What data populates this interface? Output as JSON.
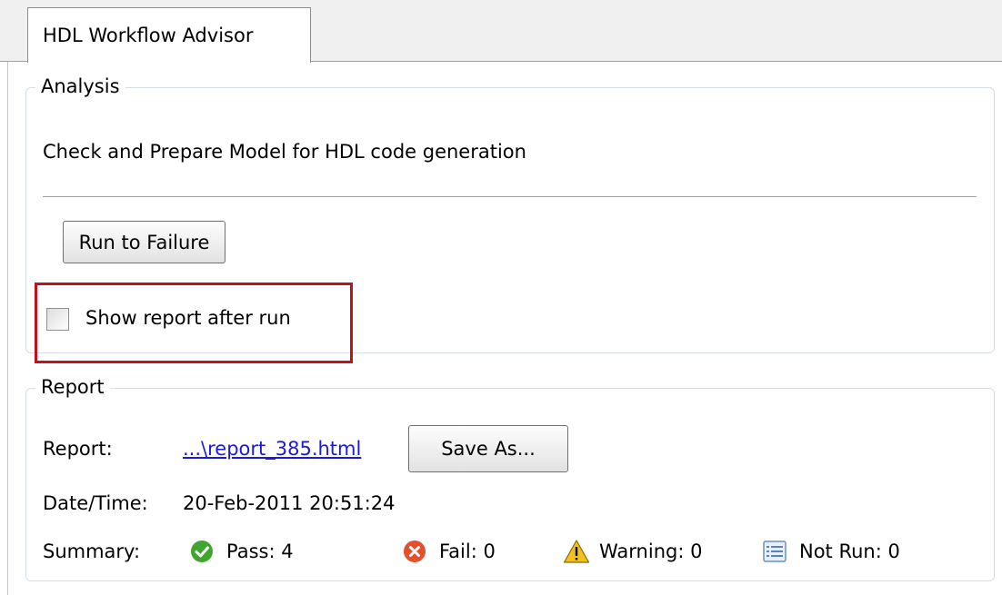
{
  "tab": {
    "label": "HDL Workflow Advisor"
  },
  "analysis": {
    "title": "Analysis",
    "description": "Check and Prepare Model for HDL code generation",
    "run_button": "Run to Failure",
    "show_report_label": "Show report after run",
    "show_report_checked": false
  },
  "report": {
    "title": "Report",
    "report_label": "Report:",
    "report_link": "...\\report_385.html",
    "save_as": "Save As...",
    "datetime_label": "Date/Time:",
    "datetime_value": "20-Feb-2011 20:51:24",
    "summary_label": "Summary:",
    "pass": "Pass: 4",
    "fail": "Fail: 0",
    "warning": "Warning: 0",
    "not_run": "Not Run: 0"
  },
  "colors": {
    "highlight": "#c0121c",
    "link": "#1a1adc",
    "pass": "#3fa52f",
    "fail": "#e4502c",
    "warning": "#f2c21a"
  },
  "icons": {
    "pass": "check-circle-icon",
    "fail": "x-circle-icon",
    "warning": "warning-triangle-icon",
    "not_run": "list-icon"
  }
}
